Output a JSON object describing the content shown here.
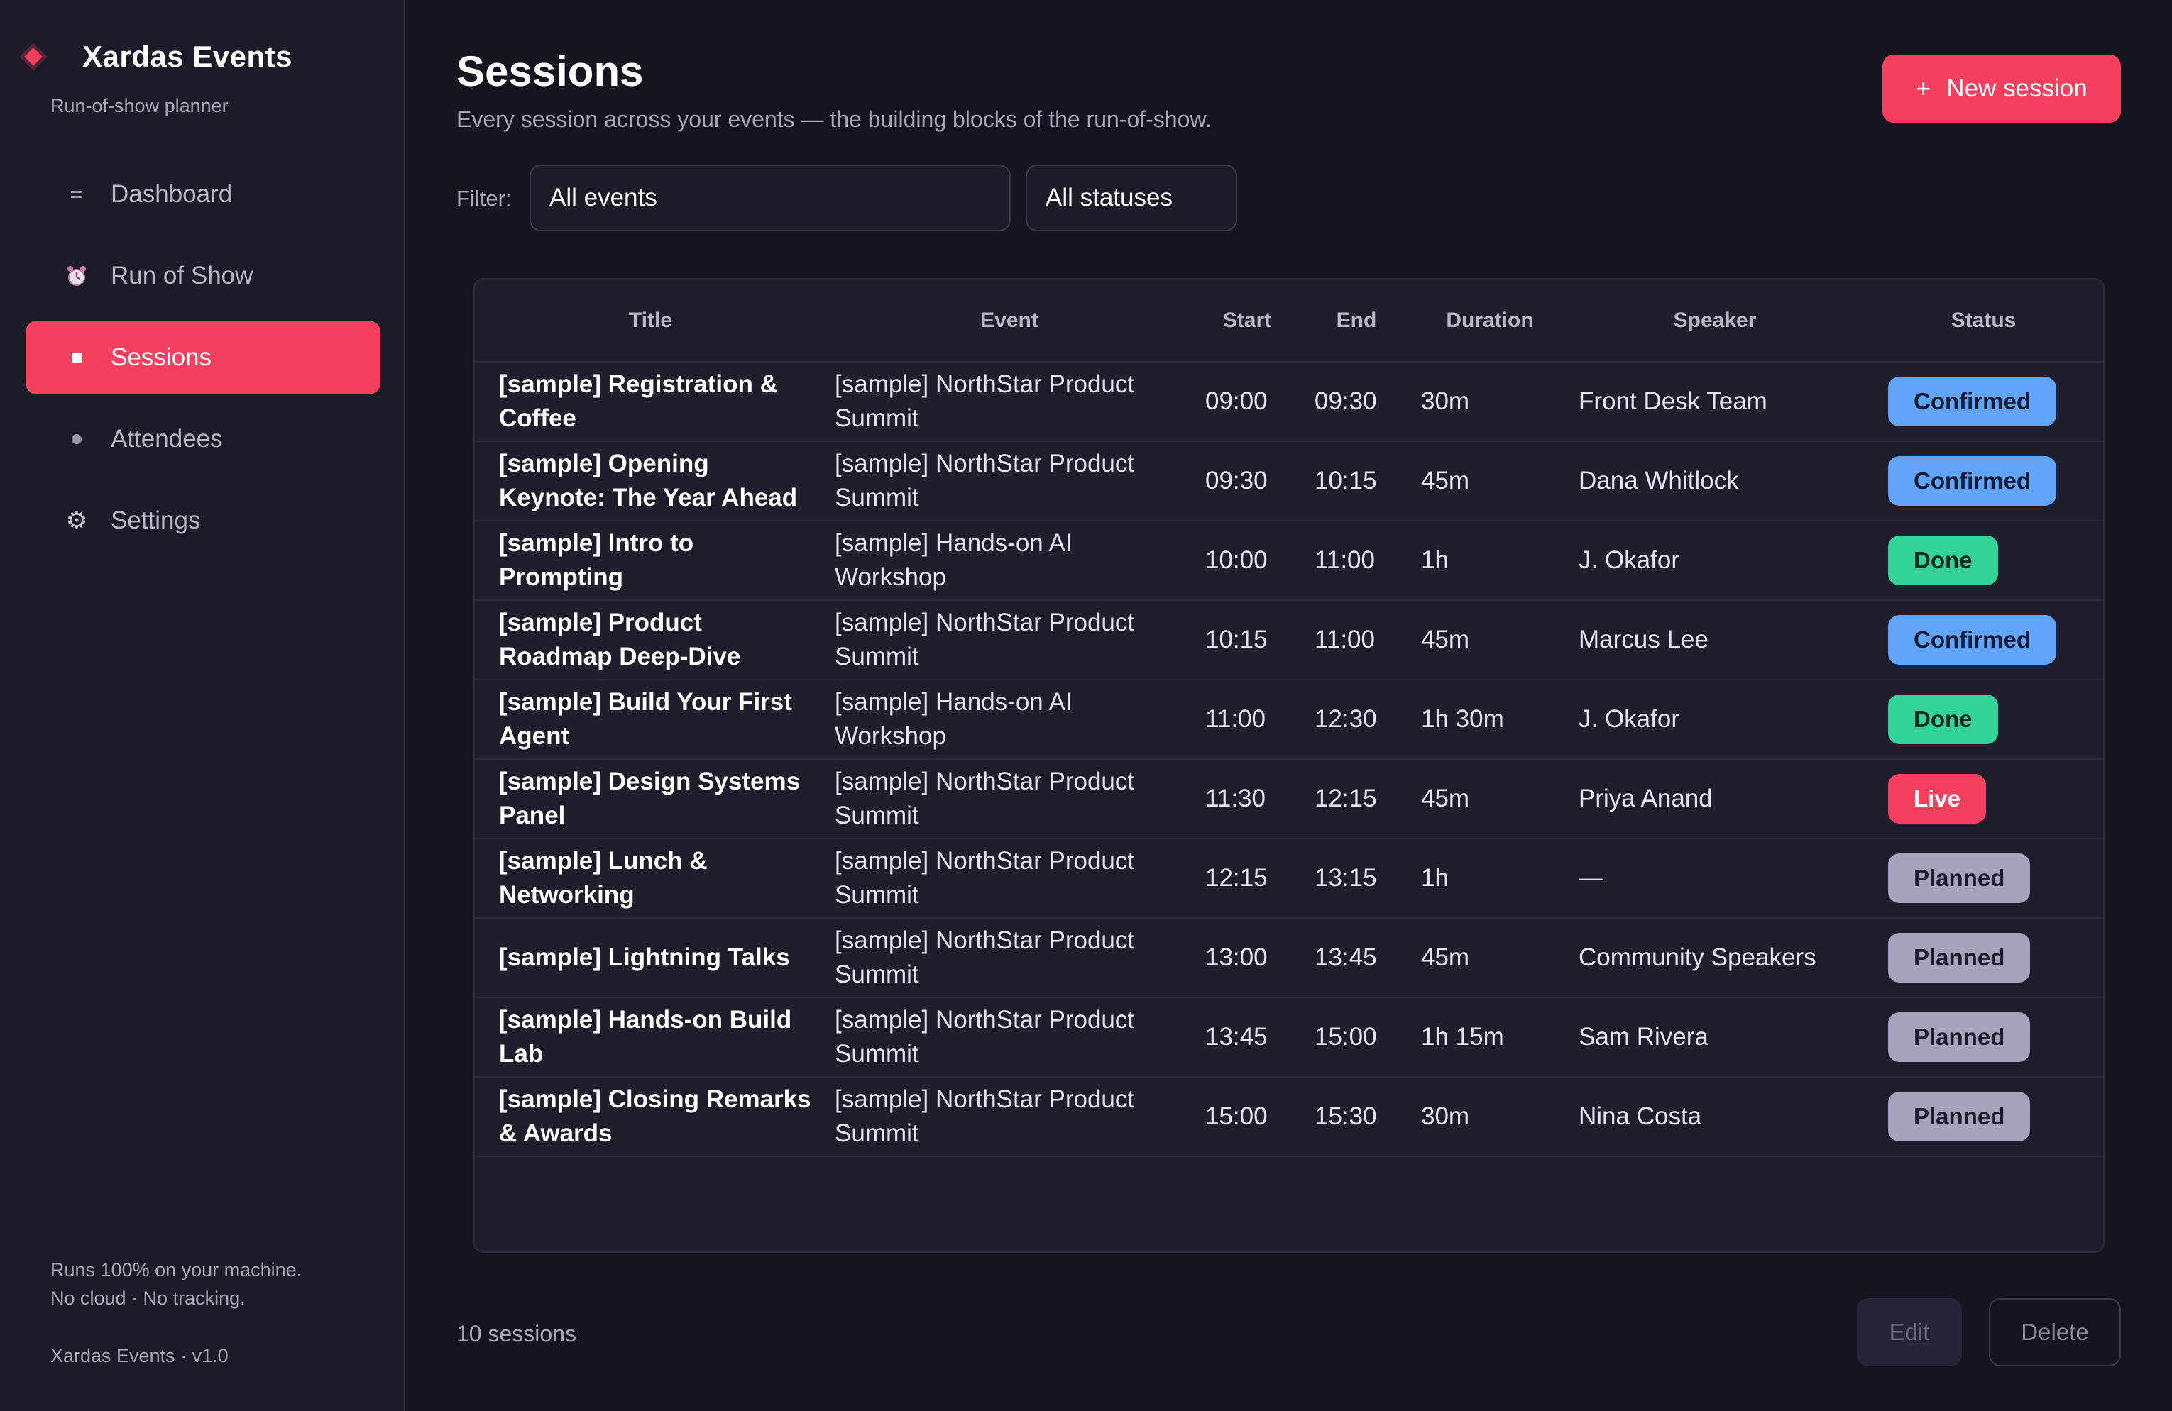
{
  "brand": {
    "title": "Xardas Events",
    "subtitle": "Run-of-show planner"
  },
  "nav": [
    {
      "label": "Dashboard",
      "icon": "list-icon"
    },
    {
      "label": "Run of Show",
      "icon": "alarm-clock-icon"
    },
    {
      "label": "Sessions",
      "icon": "square-icon",
      "active": true
    },
    {
      "label": "Attendees",
      "icon": "dot-icon"
    },
    {
      "label": "Settings",
      "icon": "gear-icon"
    }
  ],
  "sidebar_footer": {
    "line1": "Runs 100% on your machine.",
    "line2": "No cloud · No tracking.",
    "version": "Xardas Events · v1.0"
  },
  "header": {
    "title": "Sessions",
    "subtitle": "Every session across your events — the building blocks of the run-of-show.",
    "new_button": "New session",
    "new_button_icon": "+"
  },
  "filters": {
    "label": "Filter:",
    "event_selected": "All events",
    "status_selected": "All statuses"
  },
  "table": {
    "columns": [
      "Title",
      "Event",
      "Start",
      "End",
      "Duration",
      "Speaker",
      "Status"
    ],
    "rows": [
      {
        "title": "[sample] Registration & Coffee",
        "event": "[sample] NorthStar Product Summit",
        "start": "09:00",
        "end": "09:30",
        "duration": "30m",
        "speaker": "Front Desk Team",
        "status": "Confirmed"
      },
      {
        "title": "[sample] Opening Keynote: The Year Ahead",
        "event": "[sample] NorthStar Product Summit",
        "start": "09:30",
        "end": "10:15",
        "duration": "45m",
        "speaker": "Dana Whitlock",
        "status": "Confirmed"
      },
      {
        "title": "[sample] Intro to Prompting",
        "event": "[sample] Hands-on AI Workshop",
        "start": "10:00",
        "end": "11:00",
        "duration": "1h",
        "speaker": "J. Okafor",
        "status": "Done"
      },
      {
        "title": "[sample] Product Roadmap Deep-Dive",
        "event": "[sample] NorthStar Product Summit",
        "start": "10:15",
        "end": "11:00",
        "duration": "45m",
        "speaker": "Marcus Lee",
        "status": "Confirmed"
      },
      {
        "title": "[sample] Build Your First Agent",
        "event": "[sample] Hands-on AI Workshop",
        "start": "11:00",
        "end": "12:30",
        "duration": "1h 30m",
        "speaker": "J. Okafor",
        "status": "Done"
      },
      {
        "title": "[sample] Design Systems Panel",
        "event": "[sample] NorthStar Product Summit",
        "start": "11:30",
        "end": "12:15",
        "duration": "45m",
        "speaker": "Priya Anand",
        "status": "Live"
      },
      {
        "title": "[sample] Lunch & Networking",
        "event": "[sample] NorthStar Product Summit",
        "start": "12:15",
        "end": "13:15",
        "duration": "1h",
        "speaker": "—",
        "status": "Planned"
      },
      {
        "title": "[sample] Lightning Talks",
        "event": "[sample] NorthStar Product Summit",
        "start": "13:00",
        "end": "13:45",
        "duration": "45m",
        "speaker": "Community Speakers",
        "status": "Planned"
      },
      {
        "title": "[sample] Hands-on Build Lab",
        "event": "[sample] NorthStar Product Summit",
        "start": "13:45",
        "end": "15:00",
        "duration": "1h 15m",
        "speaker": "Sam Rivera",
        "status": "Planned"
      },
      {
        "title": "[sample] Closing Remarks & Awards",
        "event": "[sample] NorthStar Product Summit",
        "start": "15:00",
        "end": "15:30",
        "duration": "30m",
        "speaker": "Nina Costa",
        "status": "Planned"
      }
    ]
  },
  "footer": {
    "count": "10 sessions",
    "edit": "Edit",
    "delete": "Delete"
  },
  "colors": {
    "accent": "#f43f5e",
    "confirmed": "#60a5fa",
    "done": "#34d399",
    "live": "#f43f5e",
    "planned": "#a8a2bd"
  }
}
